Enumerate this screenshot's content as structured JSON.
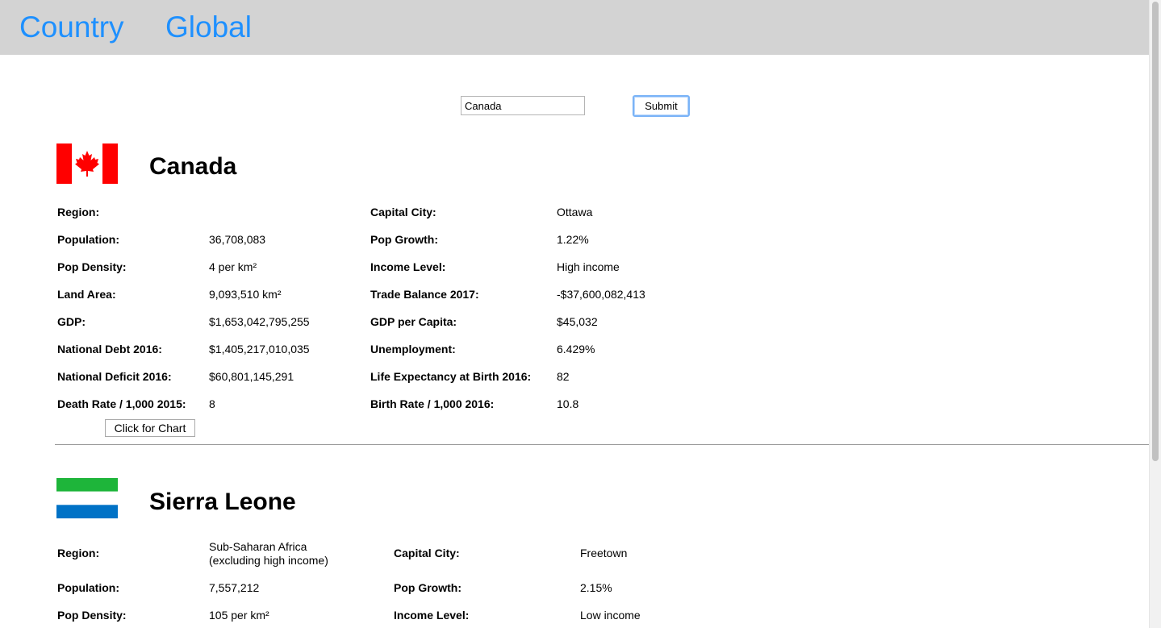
{
  "nav": {
    "country": "Country",
    "global": "Global"
  },
  "search": {
    "value": "Canada",
    "submit": "Submit"
  },
  "canada": {
    "name": "Canada",
    "labels": {
      "region": "Region:",
      "population": "Population:",
      "pop_density": "Pop Density:",
      "land_area": "Land Area:",
      "gdp": "GDP:",
      "national_debt": "National Debt 2016:",
      "national_deficit": "National Deficit 2016:",
      "death_rate": "Death Rate / 1,000 2015:",
      "capital": "Capital City:",
      "pop_growth": "Pop Growth:",
      "income_level": "Income Level:",
      "trade_balance": "Trade Balance 2017:",
      "gdp_per_capita": "GDP per Capita:",
      "unemployment": "Unemployment:",
      "life_expectancy": "Life Expectancy at Birth 2016:",
      "birth_rate": "Birth Rate / 1,000 2016:"
    },
    "values": {
      "region": "",
      "population": "36,708,083",
      "pop_density": "4 per km²",
      "land_area": "9,093,510 km²",
      "gdp": "$1,653,042,795,255",
      "national_debt": "$1,405,217,010,035",
      "national_deficit": "$60,801,145,291",
      "death_rate": "8",
      "capital": "Ottawa",
      "pop_growth": "1.22%",
      "income_level": "High income",
      "trade_balance": "-$37,600,082,413",
      "gdp_per_capita": "$45,032",
      "unemployment": "6.429%",
      "life_expectancy": "82",
      "birth_rate": "10.8"
    },
    "chart_button": "Click for Chart"
  },
  "sierra_leone": {
    "name": "Sierra Leone",
    "labels": {
      "region": "Region:",
      "population": "Population:",
      "pop_density": "Pop Density:",
      "capital": "Capital City:",
      "pop_growth": "Pop Growth:",
      "income_level": "Income Level:"
    },
    "values": {
      "region_line1": "Sub-Saharan Africa",
      "region_line2": "(excluding high income)",
      "population": "7,557,212",
      "pop_density": "105 per km²",
      "capital": "Freetown",
      "pop_growth": "2.15%",
      "income_level": "Low income"
    }
  },
  "colors": {
    "nav_bg": "#d3d3d3",
    "nav_link": "#1e90ff",
    "flag_red": "#ff0000",
    "flag_green": "#1eb53a",
    "flag_blue": "#0072c6"
  }
}
